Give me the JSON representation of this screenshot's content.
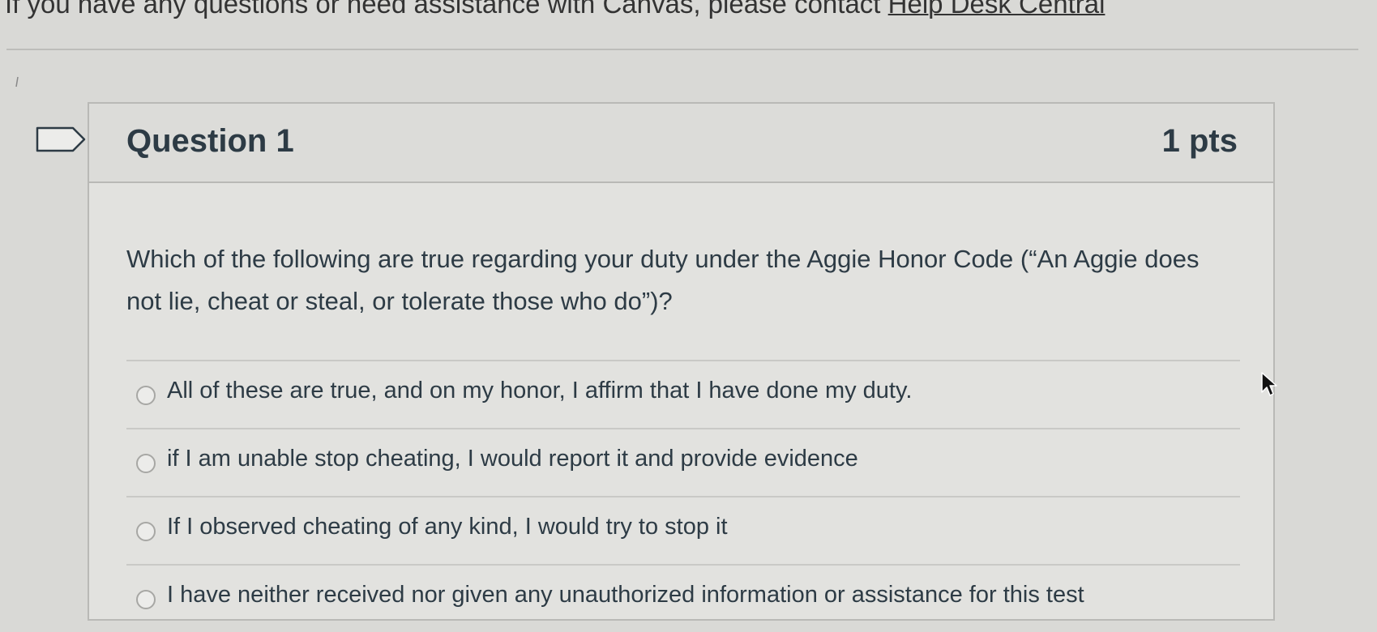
{
  "banner": {
    "text": "If you have any questions or need assistance with Canvas, please contact",
    "link_label": "Help Desk Central"
  },
  "question": {
    "title": "Question 1",
    "points": "1 pts",
    "text": "Which of the following are true regarding your duty under the Aggie Honor Code (“An Aggie does not lie, cheat or steal, or tolerate those who do”)?",
    "answers": [
      {
        "label": "All of these are true, and on my honor, I affirm that I have done my duty."
      },
      {
        "label": "if I am unable stop cheating, I would report it and provide evidence"
      },
      {
        "label": "If I observed cheating of any kind, I would try to stop it"
      },
      {
        "label": "I have neither received nor given any unauthorized information or assistance for this test"
      }
    ]
  },
  "icons": {
    "flag": "flag-outline-icon",
    "cursor": "mouse-pointer-icon"
  },
  "colors": {
    "background": "#d9d9d6",
    "text": "#2d3b45",
    "border": "#b9b9b6"
  }
}
